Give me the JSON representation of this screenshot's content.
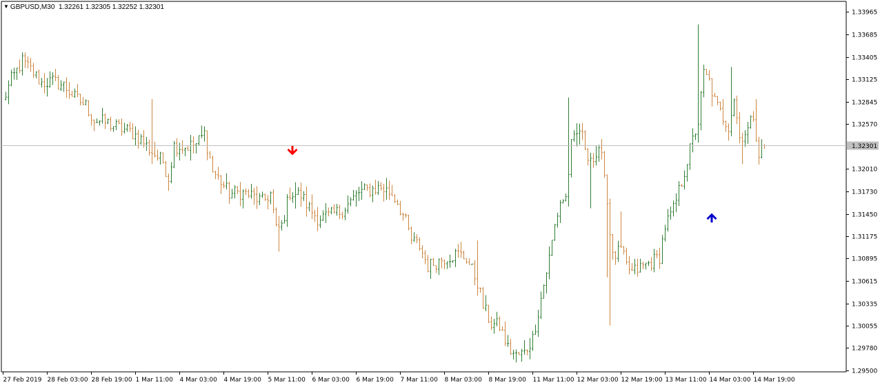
{
  "header": {
    "symbol": "GBPUSD,M30",
    "ohlc": "1.32261 1.32305 1.32252 1.32301"
  },
  "colors": {
    "bull": "#2e7d32",
    "bear": "#cd853f",
    "grid_line": "#c0c0c0",
    "price_label_bg": "#c0c0c0",
    "sell_arrow": "#ff0000",
    "buy_arrow": "#0000cd",
    "axis": "#000000"
  },
  "chart_data": {
    "type": "ohlc",
    "title": "GBPUSD,M30",
    "current_price": 1.32301,
    "current_price_label": "1.32301",
    "ylim": [
      1.295,
      1.3402
    ],
    "y_ticks": [
      "1.33965",
      "1.33685",
      "1.33405",
      "1.33125",
      "1.32845",
      "1.32570",
      "1.32010",
      "1.31730",
      "1.31450",
      "1.31175",
      "1.30895",
      "1.30615",
      "1.30335",
      "1.30055",
      "1.29780",
      "1.29500"
    ],
    "x_ticks": [
      "27 Feb 2019",
      "28 Feb 03:00",
      "28 Feb 19:00",
      "1 Mar 11:00",
      "4 Mar 03:00",
      "4 Mar 19:00",
      "5 Mar 11:00",
      "6 Mar 03:00",
      "6 Mar 19:00",
      "7 Mar 11:00",
      "8 Mar 03:00",
      "8 Mar 19:00",
      "11 Mar 11:00",
      "12 Mar 03:00",
      "12 Mar 19:00",
      "13 Mar 11:00",
      "14 Mar 03:00",
      "14 Mar 19:00"
    ],
    "x_tick_bar_index": [
      0,
      16,
      32,
      48,
      64,
      80,
      96,
      112,
      128,
      144,
      160,
      176,
      192,
      208,
      224,
      240,
      256,
      272
    ],
    "bar_count": 276,
    "close_path": [
      [
        0,
        1.3285
      ],
      [
        3,
        1.3312
      ],
      [
        7,
        1.3335
      ],
      [
        10,
        1.3325
      ],
      [
        14,
        1.3308
      ],
      [
        18,
        1.331
      ],
      [
        22,
        1.3305
      ],
      [
        26,
        1.329
      ],
      [
        30,
        1.328
      ],
      [
        33,
        1.3262
      ],
      [
        38,
        1.3258
      ],
      [
        42,
        1.3252
      ],
      [
        46,
        1.3248
      ],
      [
        50,
        1.3238
      ],
      [
        54,
        1.3222
      ],
      [
        58,
        1.321
      ],
      [
        60,
        1.319
      ],
      [
        62,
        1.323
      ],
      [
        66,
        1.3228
      ],
      [
        70,
        1.3232
      ],
      [
        73,
        1.3245
      ],
      [
        76,
        1.3198
      ],
      [
        79,
        1.3185
      ],
      [
        82,
        1.317
      ],
      [
        86,
        1.3172
      ],
      [
        90,
        1.3168
      ],
      [
        94,
        1.316
      ],
      [
        97,
        1.317
      ],
      [
        99,
        1.3125
      ],
      [
        101,
        1.313
      ],
      [
        104,
        1.3172
      ],
      [
        108,
        1.3168
      ],
      [
        111,
        1.3152
      ],
      [
        114,
        1.314
      ],
      [
        118,
        1.3142
      ],
      [
        122,
        1.3148
      ],
      [
        126,
        1.316
      ],
      [
        129,
        1.3172
      ],
      [
        133,
        1.3175
      ],
      [
        137,
        1.3178
      ],
      [
        141,
        1.317
      ],
      [
        143,
        1.316
      ],
      [
        146,
        1.3135
      ],
      [
        148,
        1.3112
      ],
      [
        151,
        1.3105
      ],
      [
        154,
        1.308
      ],
      [
        157,
        1.3085
      ],
      [
        161,
        1.3092
      ],
      [
        165,
        1.3095
      ],
      [
        168,
        1.309
      ],
      [
        172,
        1.306
      ],
      [
        174,
        1.303
      ],
      [
        177,
        1.3008
      ],
      [
        180,
        1.3005
      ],
      [
        183,
        1.2978
      ],
      [
        186,
        1.2968
      ],
      [
        189,
        1.2972
      ],
      [
        192,
        1.299
      ],
      [
        195,
        1.304
      ],
      [
        198,
        1.309
      ],
      [
        200,
        1.313
      ],
      [
        202,
        1.316
      ],
      [
        204,
        1.3165
      ],
      [
        206,
        1.323
      ],
      [
        209,
        1.325
      ],
      [
        212,
        1.322
      ],
      [
        215,
        1.3208
      ],
      [
        217,
        1.323
      ],
      [
        219,
        1.316
      ],
      [
        221,
        1.309
      ],
      [
        224,
        1.31
      ],
      [
        226,
        1.308
      ],
      [
        228,
        1.3072
      ],
      [
        231,
        1.3078
      ],
      [
        235,
        1.3085
      ],
      [
        238,
        1.3092
      ],
      [
        240,
        1.313
      ],
      [
        243,
        1.315
      ],
      [
        246,
        1.3185
      ],
      [
        249,
        1.3225
      ],
      [
        252,
        1.326
      ],
      [
        254,
        1.332
      ],
      [
        256,
        1.331
      ],
      [
        258,
        1.3285
      ],
      [
        261,
        1.3265
      ],
      [
        263,
        1.3255
      ],
      [
        265,
        1.329
      ],
      [
        267,
        1.324
      ],
      [
        270,
        1.325
      ],
      [
        272,
        1.3268
      ],
      [
        274,
        1.322
      ],
      [
        276,
        1.323
      ]
    ],
    "signals": [
      {
        "type": "sell",
        "bar": 105,
        "price": 1.3222
      },
      {
        "type": "buy",
        "bar": 257,
        "price": 1.3142
      }
    ],
    "grid": false,
    "legend": "none"
  }
}
